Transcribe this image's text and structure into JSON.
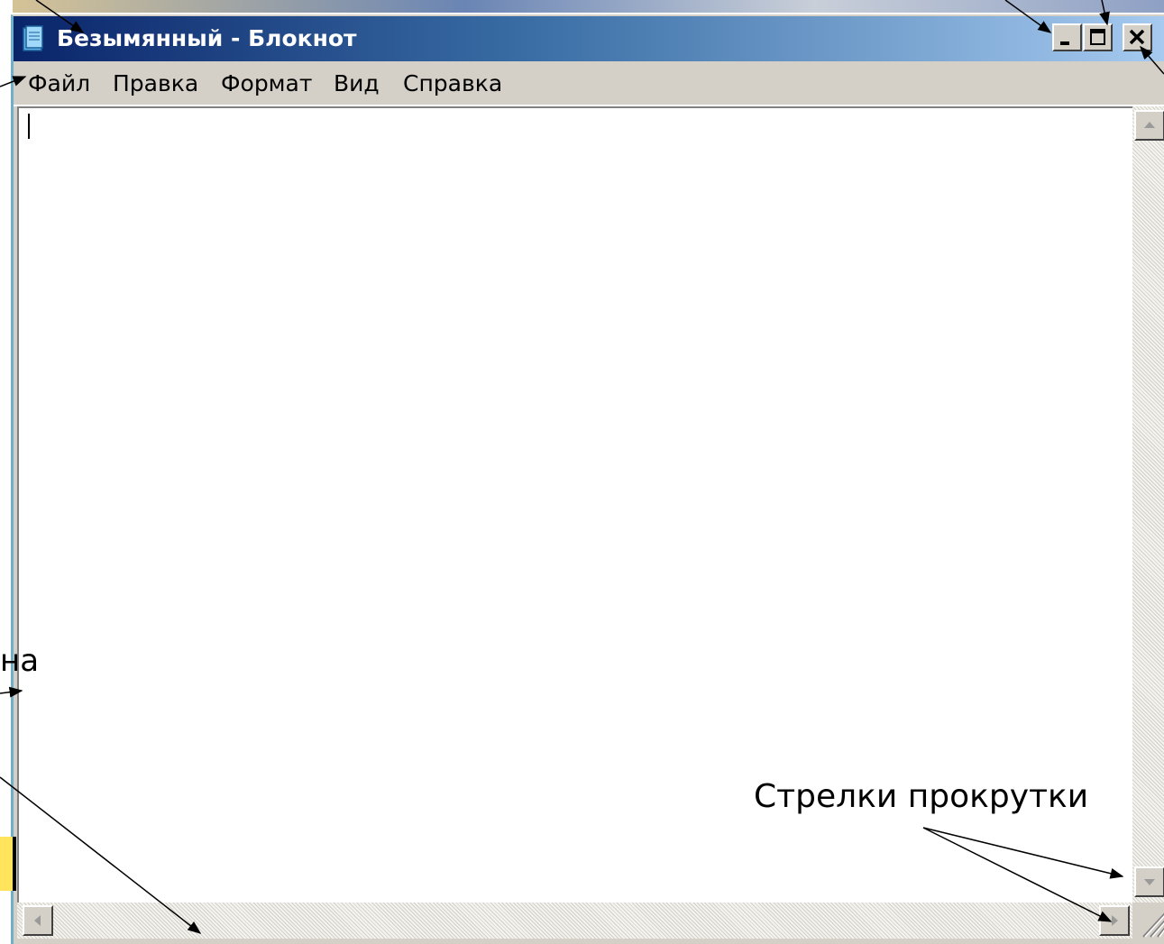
{
  "window": {
    "title": "Безымянный - Блокнот",
    "icon": "notepad-icon",
    "controls": {
      "minimize_icon": "minimize-icon",
      "maximize_icon": "maximize-icon",
      "close_icon": "close-icon"
    }
  },
  "menubar": {
    "items": [
      {
        "label": "Файл"
      },
      {
        "label": "Правка"
      },
      {
        "label": "Формат"
      },
      {
        "label": "Вид"
      },
      {
        "label": "Справка"
      }
    ]
  },
  "editor": {
    "content": ""
  },
  "scrollbars": {
    "up_icon": "arrow-up-icon",
    "down_icon": "arrow-down-icon",
    "left_icon": "arrow-left-icon",
    "right_icon": "arrow-right-icon"
  },
  "annotations": {
    "scroll_arrows_label": "Стрелки прокрутки",
    "window_fragment_label": "на"
  },
  "colors": {
    "titlebar_start": "#0a246a",
    "titlebar_end": "#a6caf0",
    "chrome": "#d4d0c8",
    "annotation_highlight": "#ffe45c"
  }
}
